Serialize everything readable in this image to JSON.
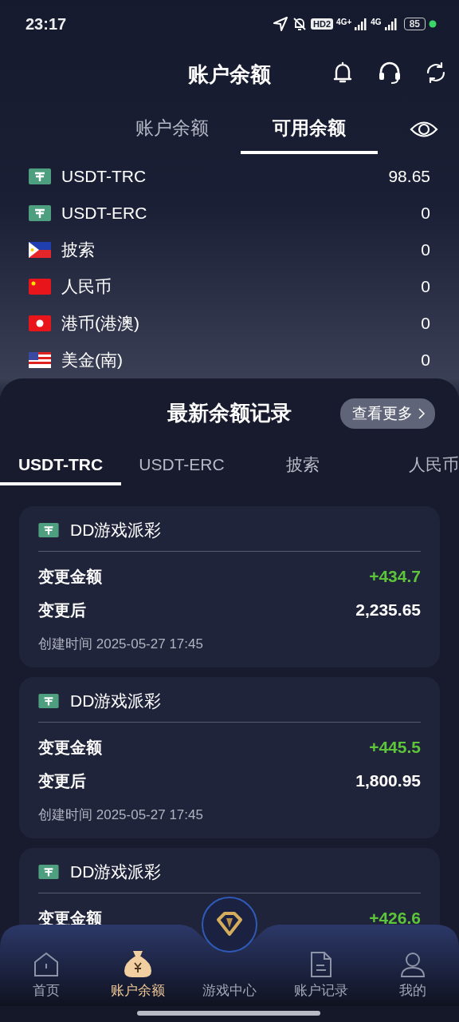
{
  "status_bar": {
    "time": "23:17",
    "hd": "HD2",
    "network_1": "4G+",
    "network_2": "4G",
    "battery": "85"
  },
  "header": {
    "title": "账户余额"
  },
  "tabs": [
    {
      "label": "账户余额",
      "selected": false
    },
    {
      "label": "可用余额",
      "selected": true
    }
  ],
  "currencies": [
    {
      "kind": "usdt",
      "name": "USDT-TRC",
      "amount": "98.65"
    },
    {
      "kind": "usdt",
      "name": "USDT-ERC",
      "amount": "0"
    },
    {
      "kind": "ph",
      "name": "披索",
      "amount": "0"
    },
    {
      "kind": "cn",
      "name": "人民币",
      "amount": "0"
    },
    {
      "kind": "hk",
      "name": "港币(港澳)",
      "amount": "0"
    },
    {
      "kind": "us",
      "name": "美金(南)",
      "amount": "0"
    }
  ],
  "records": {
    "title": "最新余额记录",
    "more_button": "查看更多",
    "tabs": [
      {
        "label": "USDT-TRC",
        "selected": true
      },
      {
        "label": "USDT-ERC",
        "selected": false
      },
      {
        "label": "披索",
        "selected": false
      },
      {
        "label": "人民币",
        "selected": false
      }
    ],
    "cards": [
      {
        "source": "DD游戏派彩",
        "rows": [
          {
            "kind": "change",
            "label": "变更金额",
            "value": "+434.7"
          },
          {
            "kind": "after",
            "label": "变更后",
            "value": "2,235.65"
          }
        ],
        "created": "创建时间 2025-05-27 17:45"
      },
      {
        "source": "DD游戏派彩",
        "rows": [
          {
            "kind": "change",
            "label": "变更金额",
            "value": "+445.5"
          },
          {
            "kind": "after",
            "label": "变更后",
            "value": "1,800.95"
          }
        ],
        "created": "创建时间 2025-05-27 17:45"
      },
      {
        "source": "DD游戏派彩",
        "rows": [
          {
            "kind": "change",
            "label": "变更金额",
            "value": "+426.6"
          }
        ]
      }
    ]
  },
  "nav": [
    {
      "kind": "home",
      "label": "首页",
      "selected": false
    },
    {
      "kind": "moneybag",
      "label": "账户余额",
      "selected": true
    },
    {
      "kind": "game",
      "label": "游戏中心",
      "selected": false
    },
    {
      "kind": "document",
      "label": "账户记录",
      "selected": false
    },
    {
      "kind": "person",
      "label": "我的",
      "selected": false
    }
  ]
}
